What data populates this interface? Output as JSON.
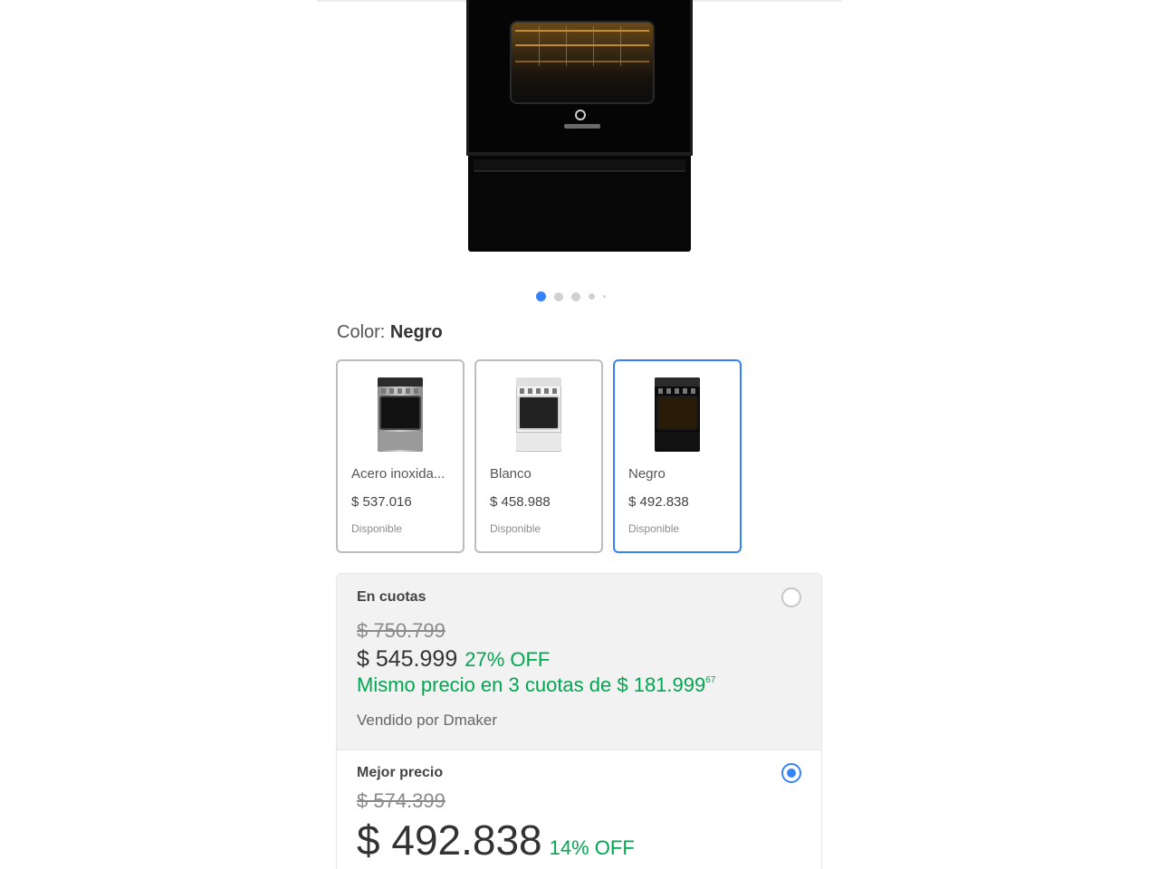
{
  "colors": {
    "accent": "#3483fa",
    "discount": "#00a650",
    "border": "#bdbdbd"
  },
  "carousel": {
    "current": 1,
    "total": 5
  },
  "color_picker": {
    "label": "Color:",
    "selected": "Negro"
  },
  "variants": [
    {
      "name": "Acero inoxida...",
      "price": "$ 537.016",
      "stock": "Disponible",
      "icon": "oven-stainless-thumbnail"
    },
    {
      "name": "Blanco",
      "price": "$ 458.988",
      "stock": "Disponible",
      "icon": "oven-white-thumbnail"
    },
    {
      "name": "Negro",
      "price": "$ 492.838",
      "stock": "Disponible",
      "icon": "oven-black-thumbnail"
    }
  ],
  "options": [
    {
      "title": "En cuotas",
      "old_price": "$ 750.799",
      "price": "$ 545.999",
      "discount": "27% OFF",
      "installments_text": "Mismo precio en 3 cuotas de $ 181.999",
      "installments_cents": "67",
      "seller": "Vendido por Dmaker",
      "selected": false
    },
    {
      "title": "Mejor precio",
      "old_price": "$ 574.399",
      "price": "$ 492.838",
      "discount": "14% OFF",
      "selected": true
    }
  ]
}
